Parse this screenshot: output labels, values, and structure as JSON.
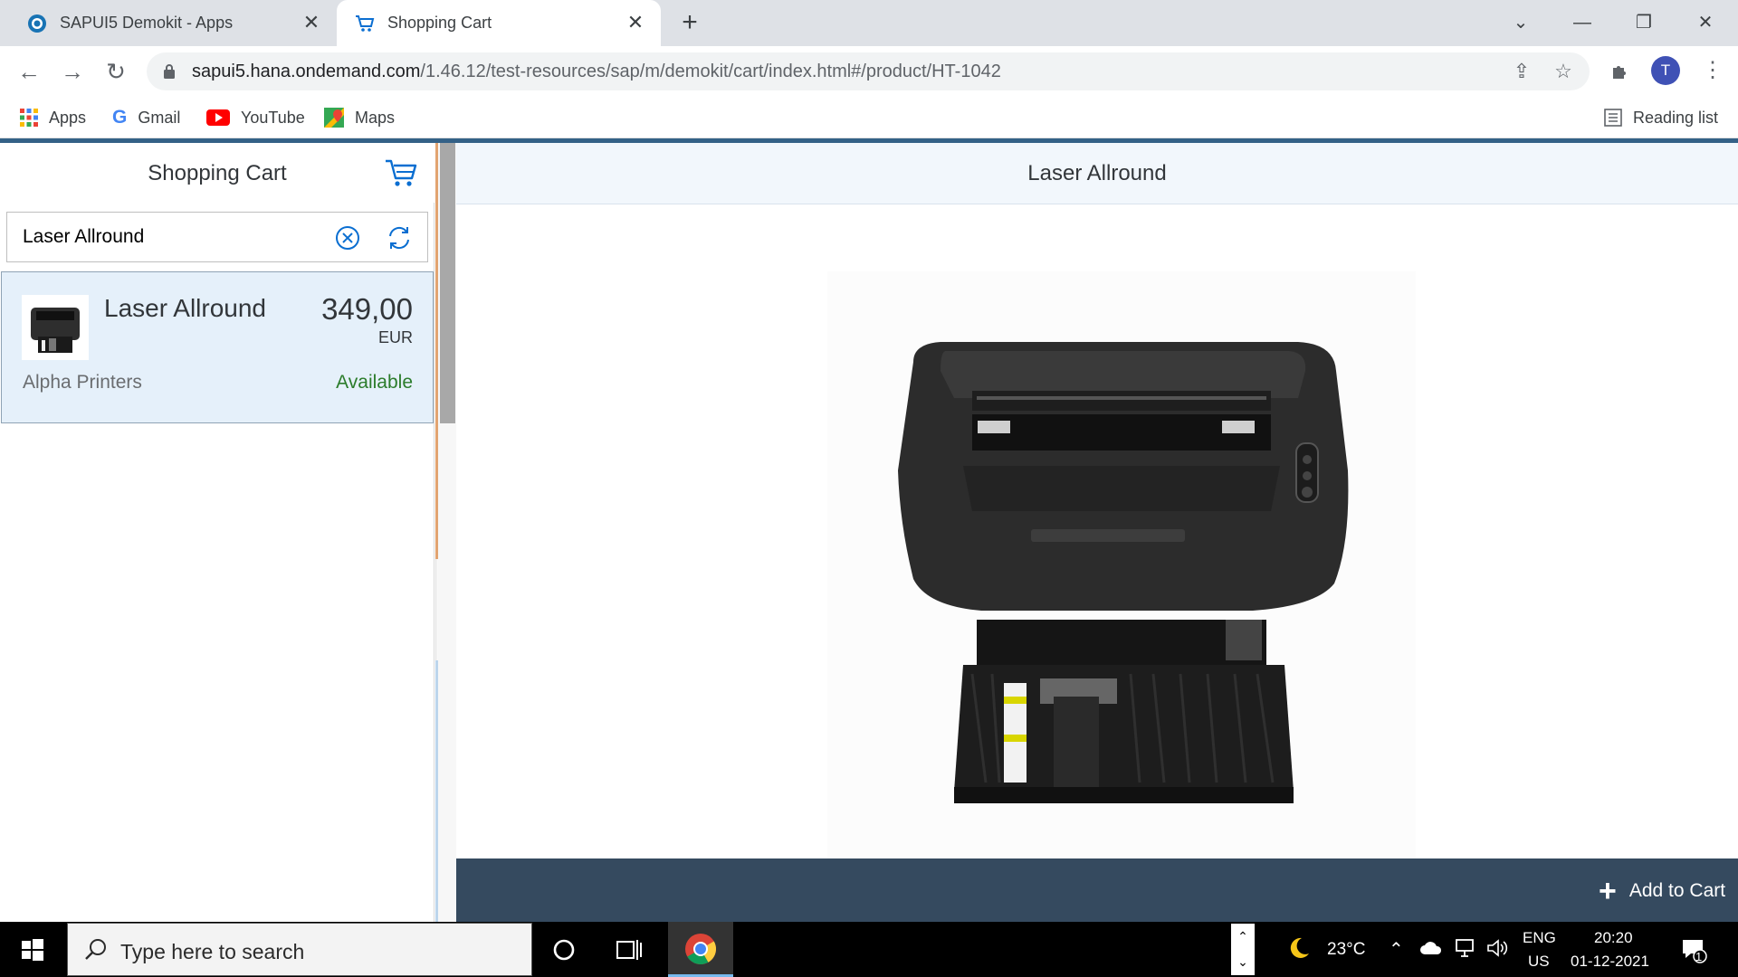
{
  "browser": {
    "tabs": [
      {
        "title": "SAPUI5 Demokit - Apps",
        "active": false
      },
      {
        "title": "Shopping Cart",
        "active": true
      }
    ],
    "address": {
      "domain": "sapui5.hana.ondemand.com",
      "path": "/1.46.12/test-resources/sap/m/demokit/cart/index.html#/product/HT-1042"
    },
    "profile_initial": "T",
    "bookmarks": [
      "Apps",
      "Gmail",
      "YouTube",
      "Maps"
    ],
    "reading_list": "Reading list"
  },
  "master": {
    "title": "Shopping Cart",
    "search": {
      "value": "Laser Allround"
    },
    "items": [
      {
        "name": "Laser Allround",
        "price": "349,00",
        "currency": "EUR",
        "supplier": "Alpha Printers",
        "status": "Available"
      }
    ]
  },
  "detail": {
    "title": "Laser Allround",
    "add_to_cart": "Add to Cart"
  },
  "taskbar": {
    "search_placeholder": "Type here to search",
    "weather": "23°C",
    "lang_top": "ENG",
    "lang_bottom": "US",
    "time": "20:20",
    "date": "01-12-2021",
    "notifications": "1"
  },
  "colors": {
    "shell_blue": "#346187",
    "footer": "#354a5f",
    "status_green": "#2b7c2b",
    "selected_item": "#e5f0fa"
  }
}
